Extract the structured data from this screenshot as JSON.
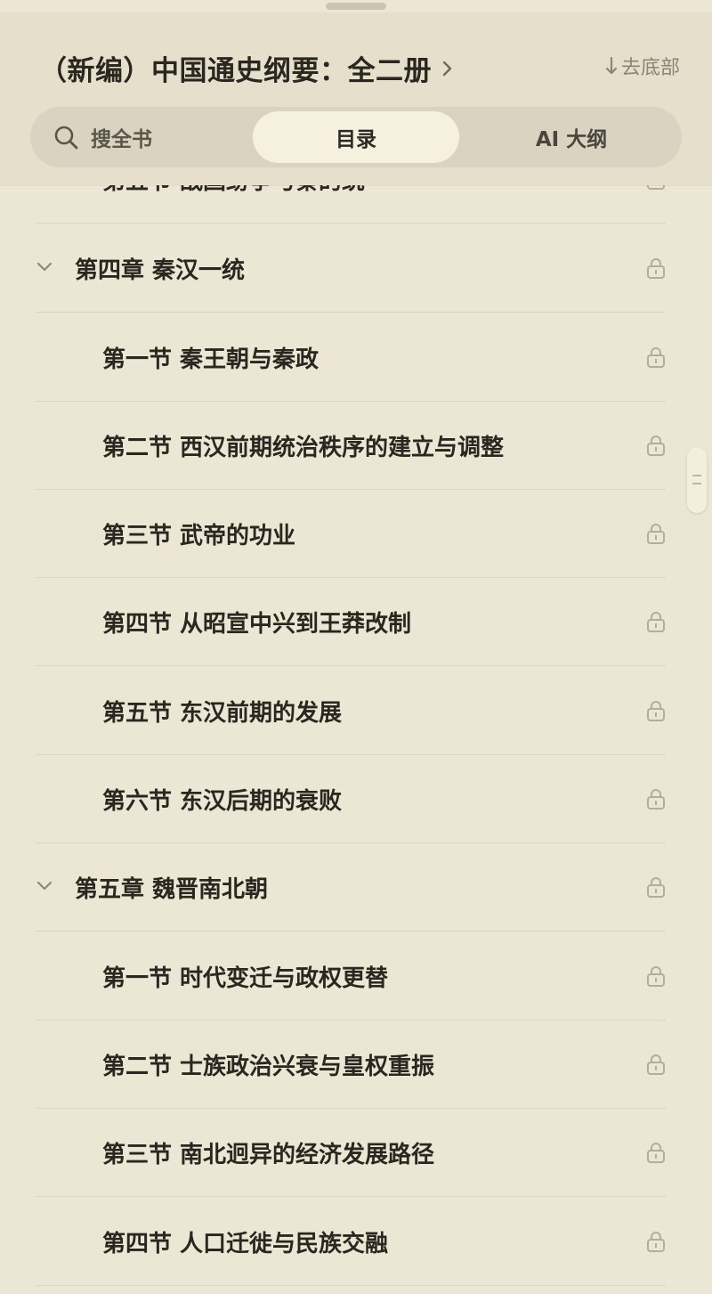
{
  "header": {
    "book_title": "（新编）中国通史纲要：全二册",
    "to_bottom_label": "去底部"
  },
  "tabs": {
    "search_label": "搜全书",
    "toc_label": "目录",
    "ai_label": "AI 大纲",
    "active": "目录"
  },
  "toc": {
    "items": [
      {
        "type": "section",
        "label": "第五节 战国纷争与秦的统一",
        "locked": true
      },
      {
        "type": "chapter",
        "label": "第四章 秦汉一统",
        "locked": true
      },
      {
        "type": "section",
        "label": "第一节 秦王朝与秦政",
        "locked": true
      },
      {
        "type": "section",
        "label": "第二节 西汉前期统治秩序的建立与调整",
        "locked": true
      },
      {
        "type": "section",
        "label": "第三节 武帝的功业",
        "locked": true
      },
      {
        "type": "section",
        "label": "第四节 从昭宣中兴到王莽改制",
        "locked": true
      },
      {
        "type": "section",
        "label": "第五节 东汉前期的发展",
        "locked": true
      },
      {
        "type": "section",
        "label": "第六节 东汉后期的衰败",
        "locked": true
      },
      {
        "type": "chapter",
        "label": "第五章 魏晋南北朝",
        "locked": true
      },
      {
        "type": "section",
        "label": "第一节 时代变迁与政权更替",
        "locked": true
      },
      {
        "type": "section",
        "label": "第二节 士族政治兴衰与皇权重振",
        "locked": true
      },
      {
        "type": "section",
        "label": "第三节 南北迥异的经济发展路径",
        "locked": true
      },
      {
        "type": "section",
        "label": "第四节 人口迁徙与民族交融",
        "locked": true
      }
    ]
  },
  "colors": {
    "background": "#ece6d4",
    "header_bg": "#e6dfcc",
    "active_tab_bg": "#f6f0df",
    "text": "#2a2620",
    "muted": "#8a8578"
  }
}
